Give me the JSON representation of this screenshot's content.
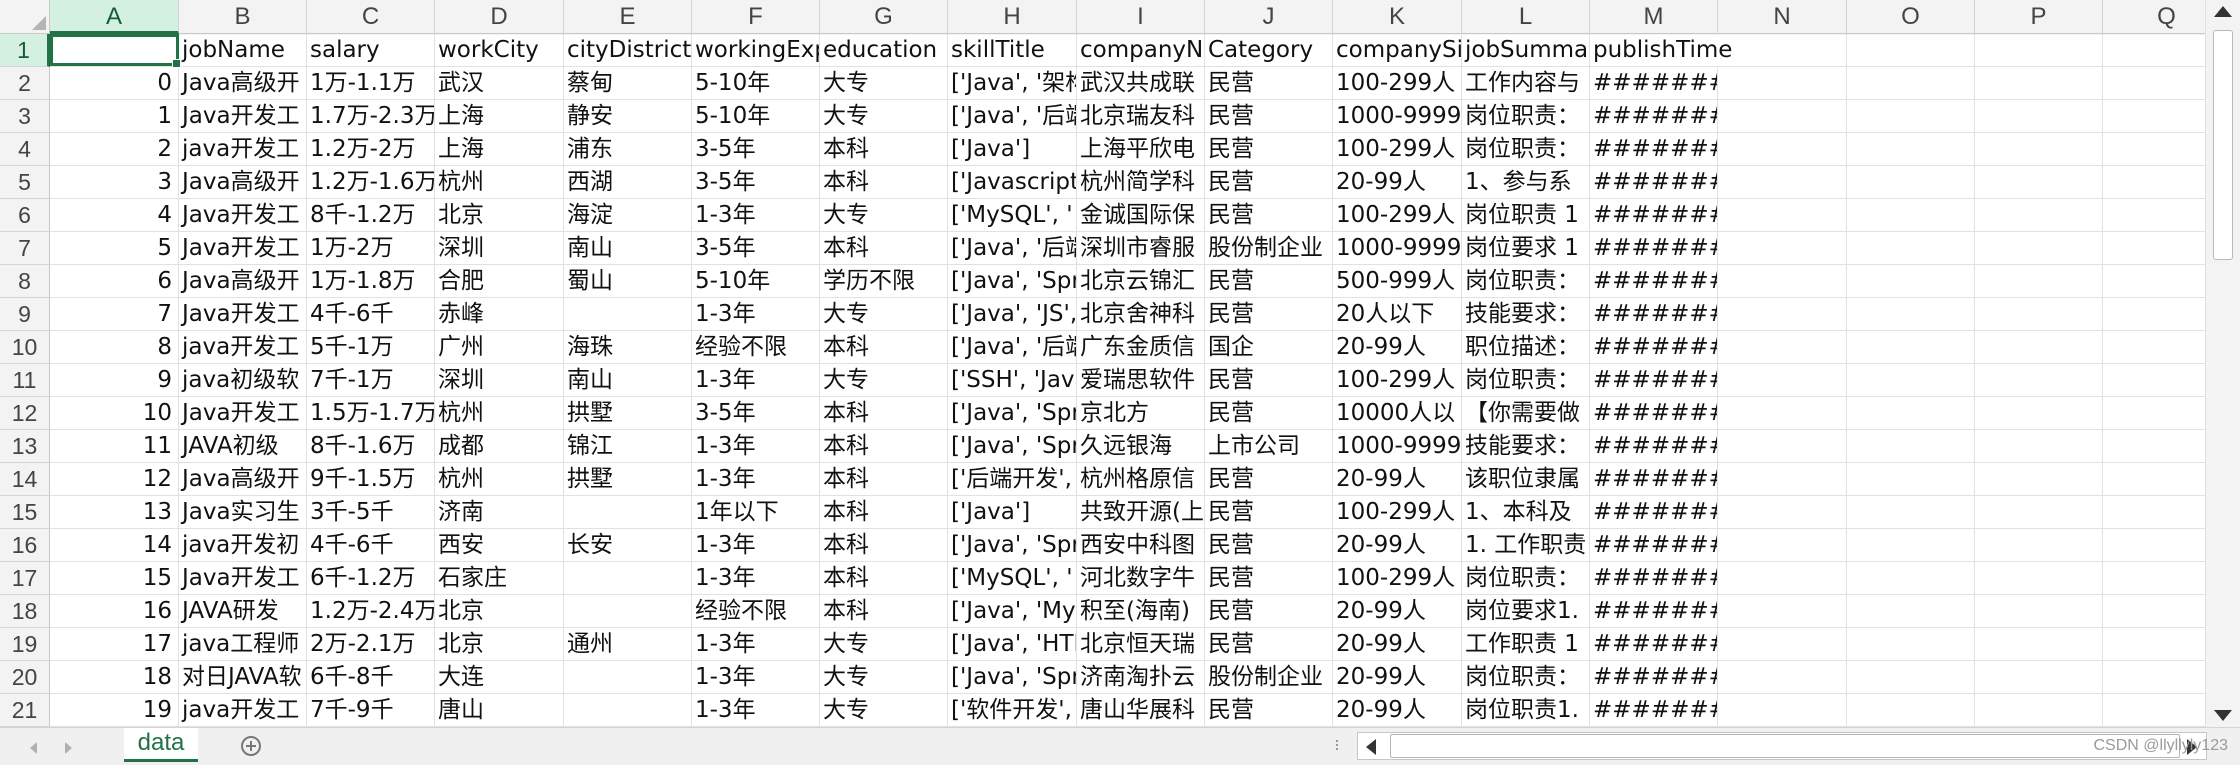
{
  "columns": [
    "A",
    "B",
    "C",
    "D",
    "E",
    "F",
    "G",
    "H",
    "I",
    "J",
    "K",
    "L",
    "M",
    "N",
    "O",
    "P",
    "Q"
  ],
  "active_column": "A",
  "active_row": 1,
  "header_row": [
    "",
    "jobName",
    "salary",
    "workCity",
    "cityDistrict",
    "workingExp",
    "education",
    "skillTitle",
    "companyN",
    "Category",
    "companySi",
    "jobSumma",
    "publishTime"
  ],
  "rows": [
    [
      "0",
      "Java高级开",
      "1万-1.1万",
      "武汉",
      "蔡甸",
      "5-10年",
      "大专",
      "['Java', '架构",
      "武汉共成联",
      "民营",
      "100-299人",
      "工作内容与",
      "#######"
    ],
    [
      "1",
      "Java开发工",
      "1.7万-2.3万",
      "上海",
      "静安",
      "5-10年",
      "大专",
      "['Java', '后端",
      "北京瑞友科",
      "民营",
      "1000-9999",
      "岗位职责：",
      "#######"
    ],
    [
      "2",
      "java开发工",
      "1.2万-2万",
      "上海",
      "浦东",
      "3-5年",
      "本科",
      "['Java']",
      "上海平欣电",
      "民营",
      "100-299人",
      "岗位职责：",
      "#######"
    ],
    [
      "3",
      "Java高级开",
      "1.2万-1.6万",
      "杭州",
      "西湖",
      "3-5年",
      "本科",
      "['Javascript",
      "杭州简学科",
      "民营",
      "20-99人",
      "1、参与系",
      "#######"
    ],
    [
      "4",
      "Java开发工",
      "8千-1.2万",
      "北京",
      "海淀",
      "1-3年",
      "大专",
      "['MySQL', '",
      "金诚国际保",
      "民营",
      "100-299人",
      "岗位职责 1",
      "#######"
    ],
    [
      "5",
      "Java开发工",
      "1万-2万",
      "深圳",
      "南山",
      "3-5年",
      "本科",
      "['Java', '后端",
      "深圳市睿服",
      "股份制企业",
      "1000-9999",
      "岗位要求 1",
      "#######"
    ],
    [
      "6",
      "Java高级开",
      "1万-1.8万",
      "合肥",
      "蜀山",
      "5-10年",
      "学历不限",
      "['Java', 'Spr",
      "北京云锦汇",
      "民营",
      "500-999人",
      "岗位职责：",
      "#######"
    ],
    [
      "7",
      "Java开发工",
      "4千-6千",
      "赤峰",
      "",
      "1-3年",
      "大专",
      "['Java', 'JS',",
      "北京舍神科",
      "民营",
      "20人以下",
      "技能要求：",
      "#######"
    ],
    [
      "8",
      "java开发工",
      "5千-1万",
      "广州",
      "海珠",
      "经验不限",
      "本科",
      "['Java', '后端",
      "广东金质信",
      "国企",
      "20-99人",
      "职位描述：",
      "#######"
    ],
    [
      "9",
      "java初级软",
      "7千-1万",
      "深圳",
      "南山",
      "1-3年",
      "大专",
      "['SSH', 'Java",
      "爱瑞思软件",
      "民营",
      "100-299人",
      "岗位职责：",
      "#######"
    ],
    [
      "10",
      "Java开发工",
      "1.5万-1.7万",
      "杭州",
      "拱墅",
      "3-5年",
      "本科",
      "['Java', 'Spr",
      "京北方",
      "民营",
      "10000人以",
      "【你需要做",
      "#######"
    ],
    [
      "11",
      "JAVA初级",
      "8千-1.6万",
      "成都",
      "锦江",
      "1-3年",
      "本科",
      "['Java', 'Spr",
      "久远银海",
      "上市公司",
      "1000-9999",
      "技能要求：",
      "#######"
    ],
    [
      "12",
      "Java高级开",
      "9千-1.5万",
      "杭州",
      "拱墅",
      "1-3年",
      "本科",
      "['后端开发',",
      "杭州格原信",
      "民营",
      "20-99人",
      "该职位隶属",
      "#######"
    ],
    [
      "13",
      "Java实习生",
      "3千-5千",
      "济南",
      "",
      "1年以下",
      "本科",
      "['Java']",
      "共致开源(上",
      "民营",
      "100-299人",
      "1、本科及",
      "#######"
    ],
    [
      "14",
      "java开发初",
      "4千-6千",
      "西安",
      "长安",
      "1-3年",
      "本科",
      "['Java', 'Spr",
      "西安中科图",
      "民营",
      "20-99人",
      "1. 工作职责",
      "#######"
    ],
    [
      "15",
      "Java开发工",
      "6千-1.2万",
      "石家庄",
      "",
      "1-3年",
      "本科",
      "['MySQL', '",
      "河北数字牛",
      "民营",
      "100-299人",
      "岗位职责：",
      "#######"
    ],
    [
      "16",
      "JAVA研发",
      "1.2万-2.4万",
      "北京",
      "",
      "经验不限",
      "本科",
      "['Java', 'My",
      "积至(海南)",
      "民营",
      "20-99人",
      "岗位要求1.",
      "#######"
    ],
    [
      "17",
      "java工程师",
      "2万-2.1万",
      "北京",
      "通州",
      "1-3年",
      "大专",
      "['Java', 'HTI",
      "北京恒天瑞",
      "民营",
      "20-99人",
      "工作职责 1",
      "#######"
    ],
    [
      "18",
      "对日JAVA软",
      "6千-8千",
      "大连",
      "",
      "1-3年",
      "大专",
      "['Java', 'Spr",
      "济南淘扑云",
      "股份制企业",
      "20-99人",
      "岗位职责：",
      "#######"
    ],
    [
      "19",
      "java开发工",
      "7千-9千",
      "唐山",
      "",
      "1-3年",
      "大专",
      "['软件开发',",
      "唐山华展科",
      "民营",
      "20-99人",
      "岗位职责1.",
      "#######"
    ]
  ],
  "sheet_tab": "data",
  "watermark": "CSDN @llyllyly123"
}
